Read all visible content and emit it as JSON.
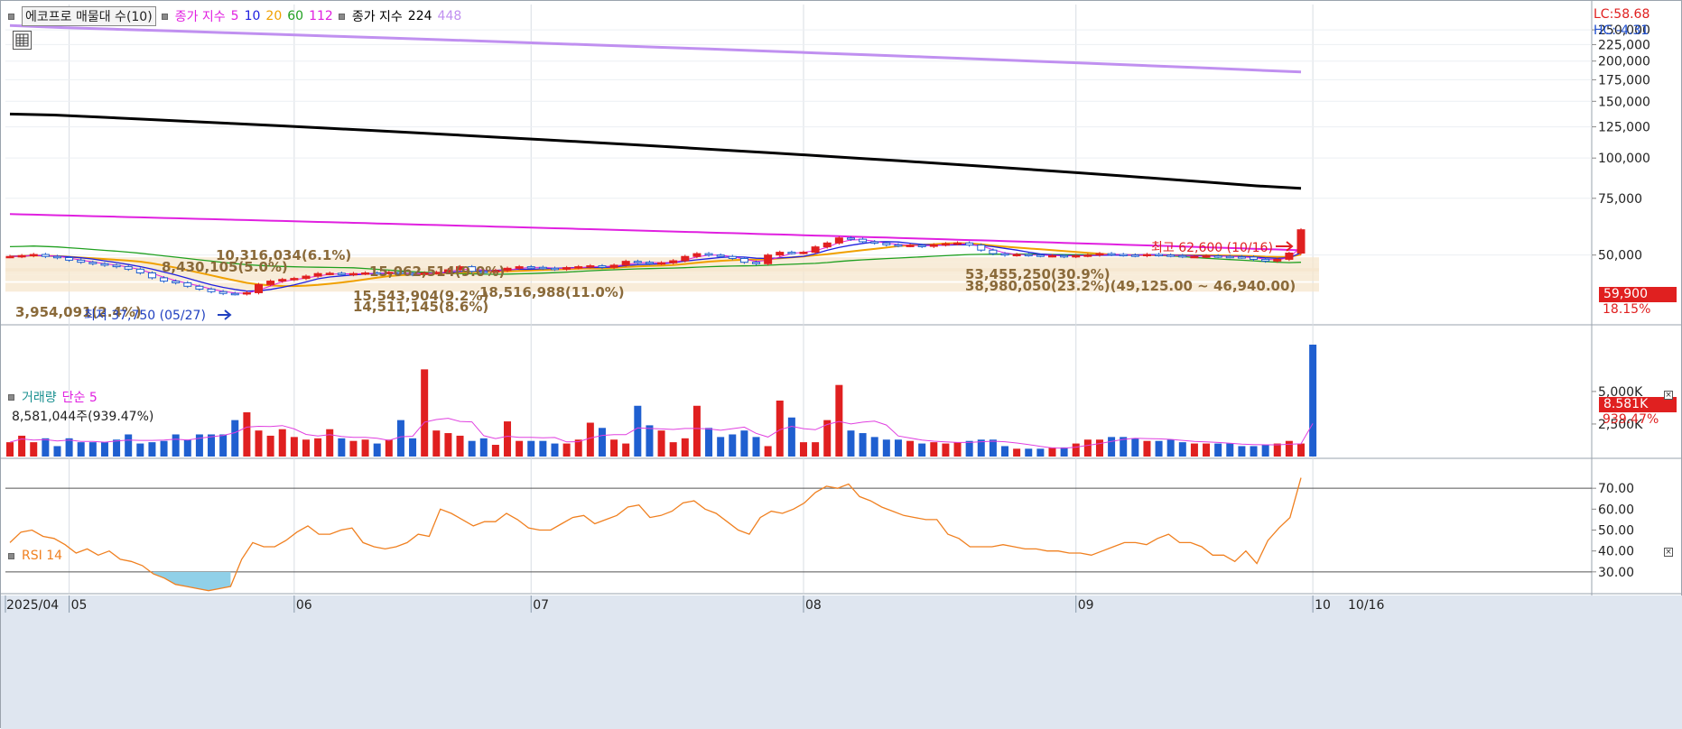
{
  "header": {
    "stock_label": "에코프로 매물대 수(10)",
    "ma_title": "종가 지수",
    "ma_periods": [
      "5",
      "10",
      "20",
      "60",
      "112"
    ],
    "ma_colors": [
      "#e020e0",
      "#2020e0",
      "#f0a000",
      "#20a020",
      "#e020e0"
    ],
    "ma2_title": "종가 지수",
    "ma2_periods": [
      "224",
      "448"
    ],
    "ma2_colors": [
      "#000000",
      "#c090f0"
    ]
  },
  "price_panel": {
    "lc_label": "LC:58.68",
    "hc_label": "HC:-4.31",
    "y_ticks": [
      "250,000",
      "225,000",
      "200,000",
      "175,000",
      "150,000",
      "125,000",
      "100,000",
      "75,000",
      "50,000"
    ],
    "y_tick_values": [
      250000,
      225000,
      200000,
      175000,
      150000,
      125000,
      100000,
      75000,
      50000
    ],
    "current_price_tag": "59,900",
    "change_pct": "18.15%",
    "high_marker": "최고 62,600 (10/16)",
    "low_marker": "최저 37,750 (05/27)",
    "volume_profile_labels": [
      "10,316,034(6.1%)",
      "8,430,105(5.0%)",
      "15,062,514(9.0%)",
      "3,954,091(2.4%)",
      "18,516,988(11.0%)",
      "14,511,145(8.6%)",
      "15,543,904(9.2%)",
      "53,455,250(30.9%)",
      "38,980,050(23.2%)(49,125.00 ~ 46,940.00)"
    ]
  },
  "volume_panel": {
    "title": "거래량",
    "ma_label": "단순 5",
    "current_value": "8,581,044주(939.47%)",
    "y_ticks": [
      "5,000K",
      "2,500K"
    ],
    "y_tick_values": [
      5000000,
      2500000
    ],
    "tag": "8.581K",
    "tag_pct": "939.47%"
  },
  "rsi_panel": {
    "title": "RSI 14",
    "y_ticks": [
      "70.00",
      "60.00",
      "50.00",
      "40.00",
      "30.00"
    ],
    "y_tick_values": [
      70,
      60,
      50,
      40,
      30
    ]
  },
  "x_axis": {
    "labels": [
      "2025/04",
      "05",
      "06",
      "07",
      "08",
      "09",
      "10"
    ],
    "end_label": "10/16"
  },
  "colors": {
    "up": "#e02020",
    "down": "#1f5fd0",
    "rsi": "#f08020",
    "vol_ma": "#e040e0",
    "ma224": "#000000",
    "ma448": "#c090f0",
    "ma112": "#e020e0",
    "ma60": "#20a020",
    "ma20": "#f0a000",
    "ma10": "#2020e0",
    "ma5": "#e020e0",
    "profile": "#f5e6cc",
    "oversold_fill": "#90d0e8"
  },
  "chart_data": {
    "type": "candlestick",
    "x_start": "2025/04",
    "x_end": "10/16",
    "price_ylim": [
      35000,
      260000
    ],
    "high": {
      "value": 62600,
      "date": "10/16"
    },
    "low": {
      "value": 37750,
      "date": "05/27"
    },
    "close": 59900,
    "closes": [
      49500,
      49800,
      50200,
      49500,
      49100,
      48200,
      47500,
      47000,
      46500,
      46000,
      45200,
      44000,
      42500,
      41500,
      41000,
      40000,
      39200,
      38500,
      38000,
      37900,
      38200,
      40500,
      41500,
      42000,
      42300,
      43000,
      43800,
      43900,
      43500,
      43800,
      44000,
      43900,
      44200,
      43800,
      43500,
      44000,
      44200,
      45000,
      46000,
      44500,
      44300,
      44800,
      45500,
      46000,
      45800,
      45500,
      45200,
      45700,
      46000,
      46300,
      45800,
      46500,
      47800,
      47500,
      47100,
      47300,
      48000,
      49500,
      50500,
      50000,
      49500,
      48800,
      47500,
      47000,
      50000,
      51000,
      50800,
      51000,
      53000,
      54500,
      56500,
      56000,
      55000,
      54500,
      53800,
      53500,
      53600,
      53200,
      53800,
      54200,
      54500,
      53700,
      51800,
      50500,
      50000,
      50200,
      50000,
      49800,
      49800,
      49500,
      49800,
      50000,
      50500,
      50200,
      50000,
      49800,
      50200,
      50000,
      49800,
      49500,
      49500,
      49700,
      49500,
      49400,
      49300,
      48500,
      47900,
      48500,
      50700,
      59900
    ],
    "volumes_k": [
      1100,
      1600,
      1100,
      1400,
      800,
      1400,
      1100,
      1100,
      1100,
      1300,
      1700,
      1000,
      1100,
      1200,
      1700,
      1300,
      1700,
      1700,
      1700,
      2800,
      3400,
      2000,
      1600,
      2100,
      1500,
      1300,
      1400,
      2100,
      1400,
      1200,
      1300,
      1000,
      1300,
      2800,
      1400,
      6700,
      2000,
      1800,
      1600,
      1200,
      1400,
      900,
      2700,
      1200,
      1200,
      1200,
      1000,
      1000,
      1300,
      2600,
      2200,
      1300,
      1000,
      3900,
      2400,
      2000,
      1100,
      1400,
      3900,
      2200,
      1500,
      1700,
      2000,
      1500,
      800,
      4300,
      3000,
      1100,
      1100,
      2800,
      5500,
      2000,
      1800,
      1500,
      1300,
      1300,
      1200,
      1000,
      1100,
      1000,
      1100,
      1200,
      1300,
      1300,
      800,
      600,
      600,
      600,
      700,
      700,
      1000,
      1300,
      1300,
      1500,
      1500,
      1400,
      1200,
      1200,
      1300,
      1100,
      1000,
      1000,
      1000,
      1000,
      800,
      800,
      900,
      1000,
      1200,
      1000,
      8600
    ],
    "rsi": [
      44,
      49,
      50,
      47,
      46,
      43,
      39,
      41,
      38,
      40,
      36,
      35,
      33,
      29,
      27,
      24,
      23,
      22,
      21,
      22,
      23,
      36,
      44,
      42,
      42,
      45,
      49,
      52,
      48,
      48,
      50,
      51,
      44,
      42,
      41,
      42,
      44,
      48,
      47,
      60,
      58,
      55,
      52,
      54,
      54,
      58,
      55,
      51,
      50,
      50,
      53,
      56,
      57,
      53,
      55,
      57,
      61,
      62,
      56,
      57,
      59,
      63,
      64,
      60,
      58,
      54,
      50,
      48,
      56,
      59,
      58,
      60,
      63,
      68,
      71,
      70,
      72,
      66,
      64,
      61,
      59,
      57,
      56,
      55,
      55,
      48,
      46,
      42,
      42,
      42,
      43,
      42,
      41,
      41,
      40,
      40,
      39,
      39,
      38,
      40,
      42,
      44,
      44,
      43,
      46,
      48,
      44,
      44,
      42,
      38,
      38,
      35,
      40,
      34,
      45,
      51,
      56,
      75
    ],
    "rsi_ylim": [
      20,
      80
    ],
    "ma224": [
      137000,
      136000,
      134000,
      132000,
      130000,
      128000,
      126000,
      124000,
      122000,
      120000,
      118000,
      116000,
      114000,
      112000,
      110000,
      108000,
      106000,
      104000,
      102000,
      100000,
      98000,
      96000,
      94000,
      92000,
      90000,
      88000,
      86000,
      84000,
      82000,
      80500
    ],
    "ma448": [
      258000,
      254000,
      251000,
      248000,
      245000,
      242000,
      239000,
      236000,
      233000,
      230000,
      227000,
      224000,
      221000,
      218000,
      215000,
      212000,
      209000,
      206000,
      203000,
      200000,
      197000,
      194000,
      191000,
      188000,
      185000
    ]
  }
}
